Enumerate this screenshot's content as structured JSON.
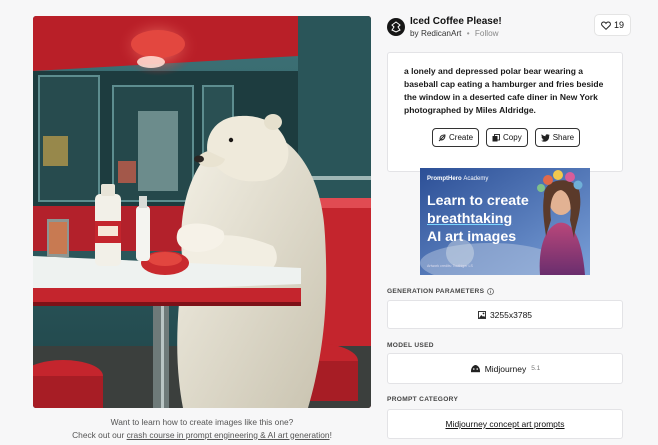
{
  "post": {
    "title": "Iced Coffee Please!",
    "author_prefix": "by",
    "author": "RedicanArt",
    "separator": "•",
    "follow_label": "Follow",
    "like_count": "19"
  },
  "prompt": {
    "text": "a lonely and depressed polar bear wearing a baseball cap eating a hamburger and fries beside the window in a deserted cafe diner in New York photographed by Miles Aldridge.",
    "buttons": [
      {
        "label": "Create",
        "icon": "feather-icon"
      },
      {
        "label": "Copy",
        "icon": "copy-icon"
      },
      {
        "label": "Share",
        "icon": "twitter-icon"
      }
    ]
  },
  "ad": {
    "brand": "PromptHero",
    "brand_suffix": "Academy",
    "line1": "Learn to create",
    "line2": "breathtaking",
    "line3": "AI art images",
    "footnote": "Artwork credits: Toothiger LS"
  },
  "sections": {
    "generation_parameters": {
      "label": "GENERATION PARAMETERS",
      "dimensions": "3255x3785"
    },
    "model_used": {
      "label": "MODEL USED",
      "model": "Midjourney",
      "version": "5.1"
    },
    "prompt_category": {
      "label": "PROMPT CATEGORY",
      "category": "Midjourney concept art prompts"
    }
  },
  "promo": {
    "line1": "Want to learn how to create images like this one?",
    "line2_prefix": "Check out our",
    "link_text": "crash course in prompt engineering & AI art generation",
    "line2_suffix": "!"
  },
  "colors": {
    "diner_red": "#c4252d",
    "teal": "#2f6468",
    "accent_dark": "#161616"
  }
}
